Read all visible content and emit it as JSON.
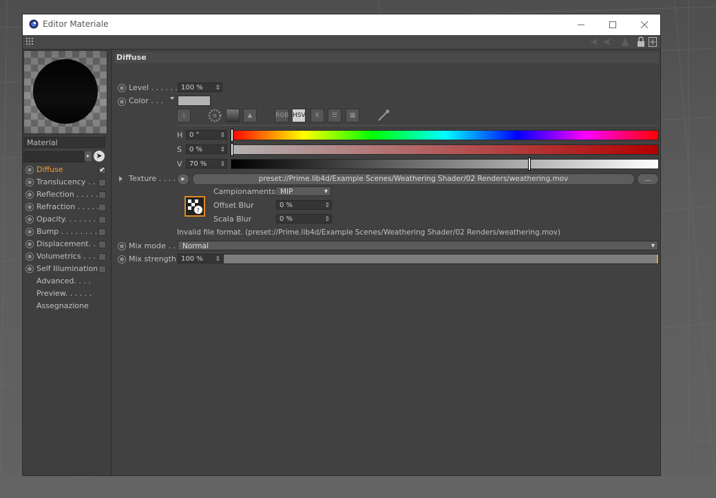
{
  "window": {
    "title": "Editor Materiale"
  },
  "sidebar": {
    "material_name": "Material",
    "channels": [
      {
        "label": "Diffuse",
        "checked": true,
        "active": true
      },
      {
        "label": "Translucency . . .",
        "checked": false
      },
      {
        "label": "Reflection  . . . . .",
        "checked": false
      },
      {
        "label": "Refraction  . . . . .",
        "checked": false
      },
      {
        "label": "Opacity. . . . . . . .",
        "checked": false
      },
      {
        "label": "Bump . . . . . . . . .",
        "checked": false
      },
      {
        "label": "Displacement. . . .",
        "checked": false
      },
      {
        "label": "Volumetrics . . . .",
        "checked": false
      },
      {
        "label": "Self Illumination",
        "checked": false
      }
    ],
    "extras": [
      "Advanced. . . .",
      "Preview. . . . . .",
      "Assegnazione"
    ]
  },
  "main": {
    "section_title": "Diffuse",
    "level": {
      "label": "Level . . . . . . .",
      "value": "100 %"
    },
    "color": {
      "label": "Color  . . .",
      "swatch": "#b3b3b3"
    },
    "color_modes": [
      "RGB",
      "HSV",
      "K"
    ],
    "hsv": {
      "h": {
        "label": "H",
        "value": "0 °",
        "level": 0.0
      },
      "s": {
        "label": "S",
        "value": "0 %",
        "level": 0.0
      },
      "v": {
        "label": "V",
        "value": "70 %",
        "level": 0.7
      }
    },
    "texture": {
      "label": "Texture  . . . . .",
      "path": "preset://Prime.lib4d/Example Scenes/Weathering Shader/02 Renders/weathering.mov",
      "more_button": "..."
    },
    "sampling": {
      "label": "Campionamento",
      "value": "MIP"
    },
    "offset_blur": {
      "label": "Offset Blur",
      "value": "0 %"
    },
    "scale_blur": {
      "label": "Scala Blur",
      "value": "0 %"
    },
    "error_message": "Invalid file format. (preset://Prime.lib4d/Example Scenes/Weathering Shader/02 Renders/weathering.mov)",
    "mix_mode": {
      "label": "Mix mode . . .",
      "value": "Normal"
    },
    "mix_strength": {
      "label": "Mix strength",
      "value": "100 %",
      "level": 1.0
    }
  }
}
